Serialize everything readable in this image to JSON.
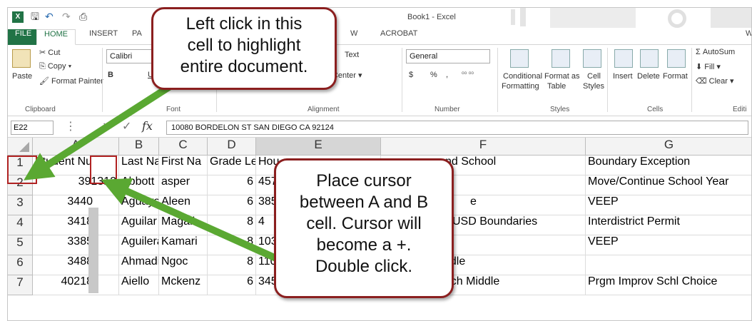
{
  "window": {
    "title": "Book1 - Excel",
    "logo": "X",
    "qat": {
      "save_icon": "save-icon",
      "undo": "↶",
      "redo": "↷",
      "preview": "⎙"
    }
  },
  "tabs": [
    "FILE",
    "HOME",
    "INSERT",
    "PA",
    "W",
    "ACROBAT",
    "W"
  ],
  "ribbon": {
    "clipboard": {
      "paste": "Paste",
      "cut": "Cut",
      "copy": "Copy",
      "format_painter": "Format Painter",
      "label": "Clipboard"
    },
    "font": {
      "name": "Calibri",
      "bold": "B",
      "underline": "U",
      "label": "Font"
    },
    "alignment": {
      "wrap_text": "Text",
      "merge_center": "Merge & Center",
      "label": "Alignment"
    },
    "number": {
      "format": "General",
      "currency": "$",
      "percent": "%",
      "comma": ",",
      "label": "Number"
    },
    "styles": {
      "conditional": "Conditional",
      "conditional2": "Formatting",
      "format_as": "Format as",
      "table": "Table",
      "cell": "Cell",
      "cell_styles": "Styles",
      "label": "Styles"
    },
    "cells": {
      "insert": "Insert",
      "delete": "Delete",
      "format": "Format",
      "label": "Cells"
    },
    "editing": {
      "autosum": "AutoSum",
      "fill": "Fill",
      "clear": "Clear",
      "label": "Editi"
    }
  },
  "formula_bar": {
    "name_box": "E22",
    "cancel": "×",
    "enter": "✓",
    "fx": "fx",
    "value": "10080 BORDELON ST SAN DIEGO CA 92124"
  },
  "grid": {
    "columns": [
      "A",
      "B",
      "C",
      "D",
      "E",
      "F",
      "G"
    ],
    "rows": [
      "1",
      "2",
      "3",
      "4",
      "5",
      "6",
      "7"
    ],
    "cells": [
      [
        "Student Nu",
        "Last Nam",
        "First Na",
        "Grade Le",
        "Hou",
        "nd School",
        "Boundary Exception"
      ],
      [
        "391312",
        "Abbott",
        "asper",
        "6",
        "457",
        "",
        "Move/Continue School Year"
      ],
      [
        "3440",
        "Aguayo",
        "Aleen",
        "6",
        "385",
        "e",
        "VEEP"
      ],
      [
        "3418",
        "Aguilar",
        "Magali",
        "8",
        "4",
        "USD Boundaries",
        "Interdistrict Permit"
      ],
      [
        "3385",
        "Aguilera",
        "Kamari",
        "8",
        "103",
        "",
        "VEEP"
      ],
      [
        "3488",
        "Ahmadi",
        "Ngoc",
        "8",
        "110",
        "ddle",
        ""
      ],
      [
        "40218",
        "Aiello",
        "Mckenz",
        "6",
        "3454 CASTLE GLEN L",
        "Millennial Tech Middle",
        "Prgm Improv Schl Choice"
      ]
    ]
  },
  "annotations": {
    "callout_top": [
      "Left click in this",
      "cell to highlight",
      "entire document."
    ],
    "callout_bottom": [
      "Place cursor",
      "between A and B",
      "cell. Cursor will",
      "become a +.",
      "Double click."
    ],
    "arrow_color": "#5aa832",
    "border_color": "#8b1f1f"
  }
}
